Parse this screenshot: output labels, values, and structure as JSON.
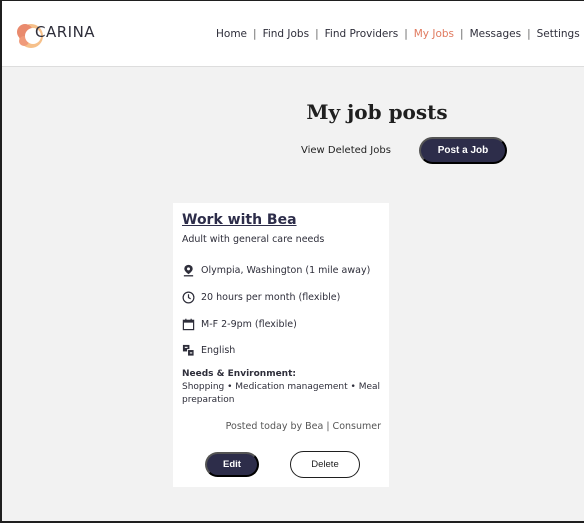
{
  "brand": {
    "name": "CARINA",
    "accent": "#e07a5f",
    "dark": "#2d2d4a"
  },
  "nav": {
    "items": [
      "Home",
      "Find Jobs",
      "Find Providers",
      "My Jobs",
      "Messages",
      "Settings"
    ],
    "active": "My Jobs",
    "separator": "|"
  },
  "page": {
    "title": "My job posts",
    "view_deleted_label": "View Deleted Jobs",
    "post_job_label": "Post a Job"
  },
  "job": {
    "title": "Work with Bea",
    "subtitle": "Adult with general care needs",
    "location": "Olympia, Washington (1 mile away)",
    "hours": "20 hours per month (flexible)",
    "schedule": "M-F 2-9pm (flexible)",
    "language": "English",
    "needs_label": "Needs & Environment:",
    "needs_text": "Shopping • Medication management • Meal preparation",
    "posted": "Posted today by Bea | Consumer",
    "edit_label": "Edit",
    "delete_label": "Delete"
  }
}
